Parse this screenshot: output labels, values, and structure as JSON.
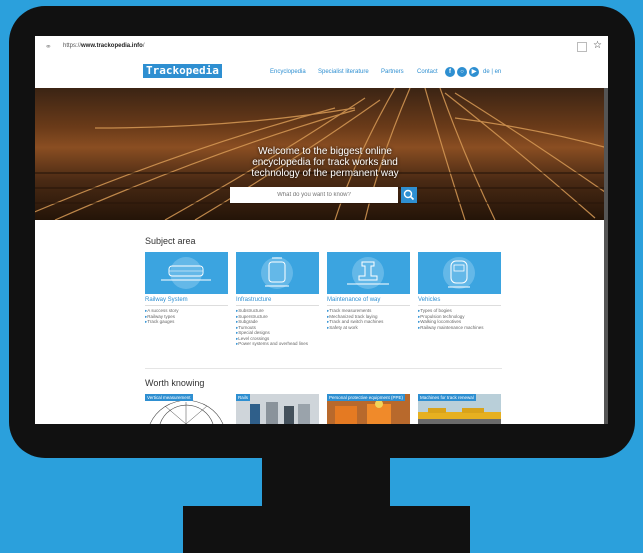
{
  "browser": {
    "url_prefix": "https://",
    "url_domain": "www.trackopedia.info",
    "url_suffix": "/"
  },
  "nav": {
    "logo": "Trackopedia",
    "links": [
      "Encyclopedia",
      "Specialist literature",
      "Partners",
      "Contact"
    ],
    "language": "de | en"
  },
  "hero": {
    "title": "Welcome to the biggest online encyclopedia for track works and technology of the permanent way",
    "search_placeholder": "What do you want to know?"
  },
  "subject_area": {
    "title": "Subject area",
    "cards": [
      {
        "title": "Railway System",
        "items": [
          "A success story",
          "Railway types",
          "Track gauges"
        ]
      },
      {
        "title": "Infrastructure",
        "items": [
          "Substructure",
          "Superstructure",
          "Subgrade",
          "Turnouts",
          "Special designs",
          "Level crossings",
          "Power systems and overhead lines"
        ]
      },
      {
        "title": "Maintenance of way",
        "items": [
          "Track measurements",
          "Mechanized track laying",
          "Track and switch machines",
          "Safety at work"
        ]
      },
      {
        "title": "Vehicles",
        "items": [
          "Types of bogies",
          "Propulsion technology",
          "Walking locomotives",
          "Railway maintenance machines"
        ]
      }
    ]
  },
  "worth_knowing": {
    "title": "Worth knowing",
    "cards": [
      "Vertical measurement",
      "Rails",
      "Personal protective equipment (PPE)",
      "Machines for track renewal"
    ]
  },
  "colors": {
    "background": "#2ba0dc",
    "accent": "#2e8fd1",
    "monitor": "#111111"
  }
}
